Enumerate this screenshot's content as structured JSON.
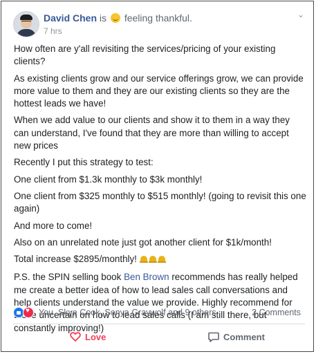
{
  "post": {
    "author": "David Chen",
    "status_prefix": "is",
    "feeling": "feeling thankful.",
    "time": "7 hrs",
    "paragraphs": {
      "p1": "How often are y'all revisiting the services/pricing of your existing clients?",
      "p2": "As existing clients grow and our service offerings grow, we can provide more value to them and they are our existing clients so they are the hottest leads we have!",
      "p3": "When we add value to our clients and show it to them in a way they can understand, I've found that they are more than willing to accept new prices",
      "p4": "Recently I put this strategy to test:",
      "p5": "One client from $1.3k monthly to $3k monthly!",
      "p6": "One client from $325 monthly to $515 monthly! (going to revisit this one again)",
      "p7": "And more to come!",
      "p8": "Also on an unrelated note just got another client for $1k/month!",
      "p9": "Total increase $2895/monthly!",
      "p10_before": "P.S. the SPIN selling book",
      "p10_mention": "Ben Brown",
      "p10_after": "recommends has really helped me create a better idea of how to lead sales call conversations and help clients understand the value we provide. Highly recommend for those uncertain on how to lead sales calls (I am still there, but constantly improving!)"
    }
  },
  "reactions": {
    "names": "You, Skye Cook, Sonya Graywolf and 9 others",
    "comments": "2 Comments"
  },
  "actions": {
    "love": "Love",
    "comment": "Comment"
  },
  "colors": {
    "author": "#385898",
    "love": "#f33e58",
    "like_blue": "#1877f2"
  }
}
